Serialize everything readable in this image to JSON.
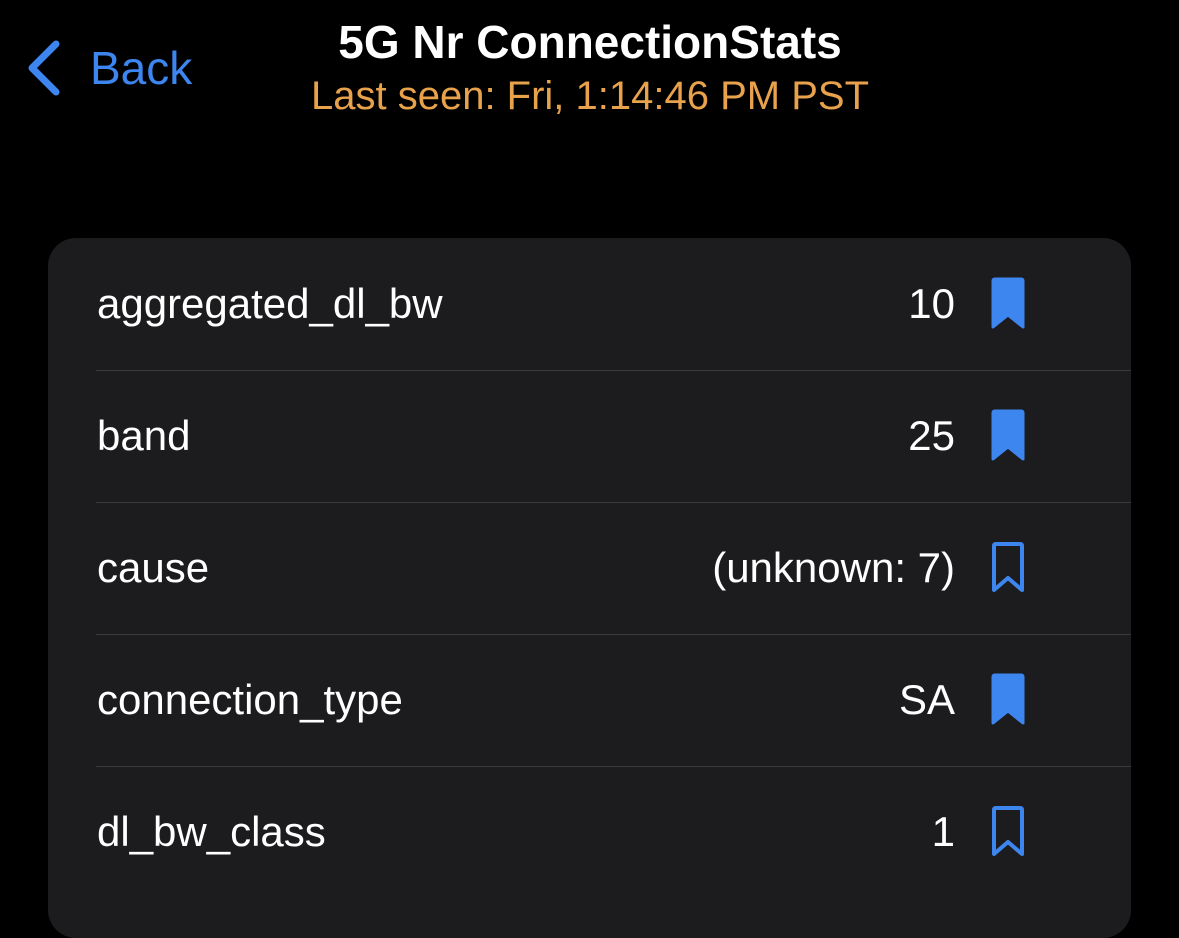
{
  "nav": {
    "back_label": "Back",
    "title": "5G Nr ConnectionStats",
    "subtitle": "Last seen: Fri, 1:14:46 PM PST"
  },
  "colors": {
    "accent": "#3d86f0",
    "subtitle": "#e8a24c",
    "background": "#000000",
    "card": "#1c1c1e",
    "separator": "#3a3a3c"
  },
  "rows": [
    {
      "key": "aggregated_dl_bw",
      "value": "10",
      "bookmark_icon": "bookmark-filled-icon",
      "bookmarked": true
    },
    {
      "key": "band",
      "value": "25",
      "bookmark_icon": "bookmark-filled-icon",
      "bookmarked": true
    },
    {
      "key": "cause",
      "value": "(unknown: 7)",
      "bookmark_icon": "bookmark-outline-icon",
      "bookmarked": false
    },
    {
      "key": "connection_type",
      "value": "SA",
      "bookmark_icon": "bookmark-filled-icon",
      "bookmarked": true
    },
    {
      "key": "dl_bw_class",
      "value": "1",
      "bookmark_icon": "bookmark-outline-icon",
      "bookmarked": false
    }
  ]
}
